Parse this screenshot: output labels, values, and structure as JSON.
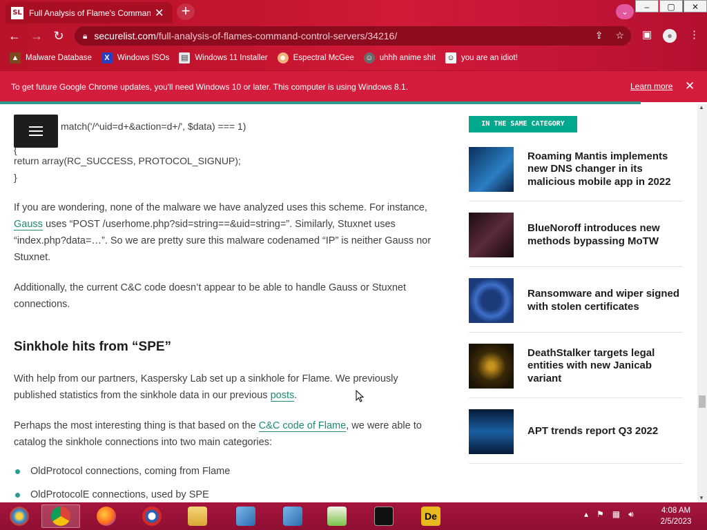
{
  "browser": {
    "tab_title": "Full Analysis of Flame's Command",
    "tab_favicon": "SL",
    "url_host": "securelist.com",
    "url_path": "/full-analysis-of-flames-command-control-servers/34216/",
    "window_buttons": [
      "–",
      "▢",
      "✕"
    ]
  },
  "bookmarks": [
    {
      "label": "Malware Database",
      "icon": "malware-icon",
      "color": "#7a4a1c"
    },
    {
      "label": "Windows ISOs",
      "icon": "x-icon",
      "color": "#2a3fbf"
    },
    {
      "label": "Windows 11 Installer",
      "icon": "doc-icon",
      "color": "#e8e8e8"
    },
    {
      "label": "Espectral McGee",
      "icon": "avatar-icon",
      "color": "#f0b47a"
    },
    {
      "label": "uhhh anime shit",
      "icon": "avatar-icon",
      "color": "#6a6a6a"
    },
    {
      "label": "you are an idiot!",
      "icon": "smiley-icon",
      "color": "#f4f4f4"
    }
  ],
  "infobar": {
    "message": "To get future Google Chrome updates, you'll need Windows 10 or later. This computer is using Windows 8.1.",
    "link": "Learn more",
    "close": "✕"
  },
  "article": {
    "code_line_1": "match('/^uid=d+&action=d+/', $data) === 1)",
    "code_line_2": "{",
    "code_line_3": "return array(RC_SUCCESS, PROTOCOL_SIGNUP);",
    "code_line_4": "}",
    "p1_a": "If you are wondering, none of the malware we have analyzed uses this scheme. For instance, ",
    "p1_link": "Gauss",
    "p1_b": " uses “POST /userhome.php?sid=string==&uid=string=”. Similarly, Stuxnet uses “index.php?data=…”. So we are pretty sure this malware codenamed “IP” is neither Gauss nor Stuxnet.",
    "p2": "Additionally, the current C&C code doesn’t appear to be able to handle Gauss or Stuxnet connections.",
    "h2": "Sinkhole hits from “SPE”",
    "p3_a": "With help from our partners, Kaspersky Lab set up a sinkhole for Flame. We previously published statistics from the sinkhole data in our previous ",
    "p3_link": "posts",
    "p3_b": ".",
    "p4_a": "Perhaps the most interesting thing is that based on the ",
    "p4_link": "C&C code of Flame",
    "p4_b": ", we were able to catalog the sinkhole connections into two main categories:",
    "bullets": [
      "OldProtocol connections, coming from Flame",
      "OldProtocolE connections, used by SPE"
    ]
  },
  "sidebar": {
    "category_label": "IN THE SAME CATEGORY",
    "related": [
      {
        "title": "Roaming Mantis implements new DNS changer in its malicious mobile app in 2022",
        "thumb": "#1d4f8a"
      },
      {
        "title": "BlueNoroff introduces new methods bypassing MoTW",
        "thumb": "#3a1f28"
      },
      {
        "title": "Ransomware and wiper signed with stolen certificates",
        "thumb": "#2f5aa8"
      },
      {
        "title": "DeathStalker targets legal entities with new Janicab variant",
        "thumb": "#7a5a10"
      },
      {
        "title": "APT trends report Q3 2022",
        "thumb": "#0f3a6a"
      }
    ]
  },
  "taskbar": {
    "apps": [
      "start-icon",
      "chrome-icon",
      "firefox-icon",
      "obama-icon",
      "explorer-icon",
      "installer-icon",
      "installer-icon",
      "notepad-icon",
      "cmd-icon",
      "de-icon"
    ],
    "clock_time": "4:08 AM",
    "clock_date": "2/5/2023"
  },
  "colors": {
    "accent": "#2f9a8e",
    "chrome_bg": "#c4152f",
    "taskbar": "#9a1236"
  }
}
